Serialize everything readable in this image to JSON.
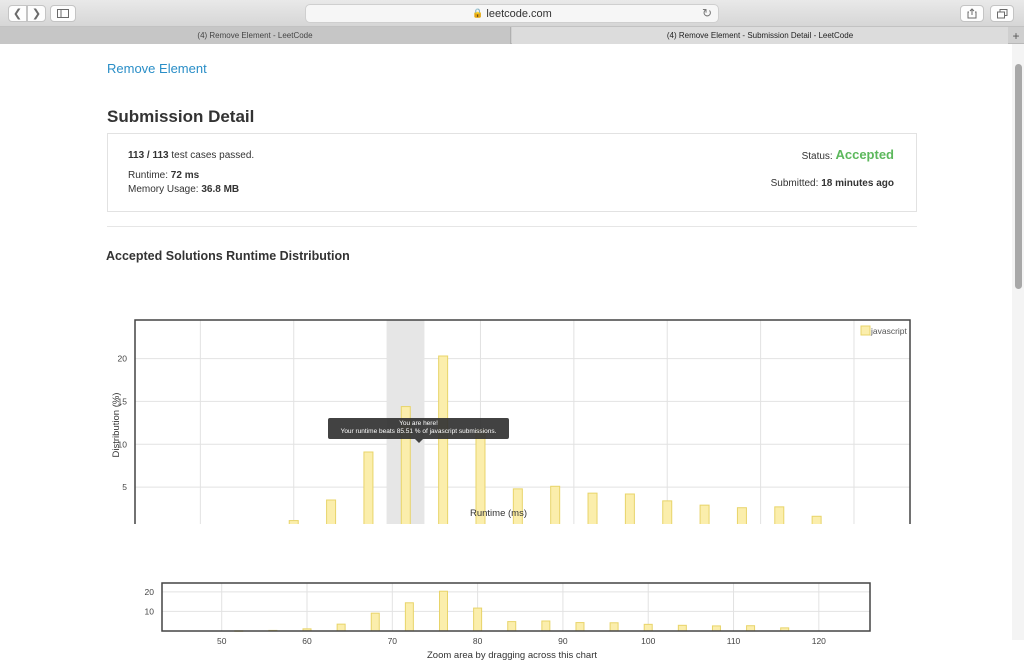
{
  "browser": {
    "url": "leetcode.com",
    "tabs": [
      {
        "label": "(4) Remove Element - LeetCode",
        "active": false
      },
      {
        "label": "(4) Remove Element - Submission Detail - LeetCode",
        "active": true
      }
    ],
    "new_tab": "+"
  },
  "header": {
    "problem_link": "Remove Element",
    "title": "Submission Detail"
  },
  "detail": {
    "passed": "113 / 113",
    "passed_suffix": " test cases passed.",
    "runtime_label": "Runtime: ",
    "runtime_value": "72 ms",
    "memory_label": "Memory Usage: ",
    "memory_value": "36.8 MB",
    "status_label": "Status: ",
    "status_value": "Accepted",
    "submitted_label": "Submitted: ",
    "submitted_value": "18 minutes ago",
    "status_color": "#5cb85c"
  },
  "section_title": "Accepted Solutions Runtime Distribution",
  "tooltip": {
    "line1": "You are here!",
    "line2": "Your runtime beats 85.51 % of javascript submissions."
  },
  "chart_data": {
    "type": "bar",
    "series": [
      {
        "name": "javascript",
        "x": [
          52,
          56,
          60,
          64,
          68,
          72,
          76,
          80,
          84,
          88,
          92,
          96,
          100,
          104,
          108,
          112,
          116
        ],
        "values": [
          0.1,
          0.3,
          1.1,
          3.5,
          9.1,
          14.4,
          20.3,
          11.7,
          4.8,
          5.1,
          4.3,
          4.2,
          3.4,
          2.9,
          2.6,
          2.7,
          1.6
        ]
      }
    ],
    "highlight_range": [
      70,
      74
    ],
    "xlabel": "Runtime (ms)",
    "ylabel": "Distribution (%)",
    "xlim": [
      43,
      126
    ],
    "ylim": [
      0,
      24.5
    ],
    "xticks": [
      50,
      60,
      70,
      80,
      90,
      100,
      110,
      120
    ],
    "yticks": [
      5,
      10,
      15,
      20
    ],
    "zoom_yticks": [
      10,
      20
    ],
    "zoom_caption": "Zoom area by dragging across this chart",
    "legend_position": "top-right",
    "colors": {
      "fill": "#fbeeac",
      "stroke": "#e8d46a",
      "highlight": "#e6e6e6"
    }
  }
}
